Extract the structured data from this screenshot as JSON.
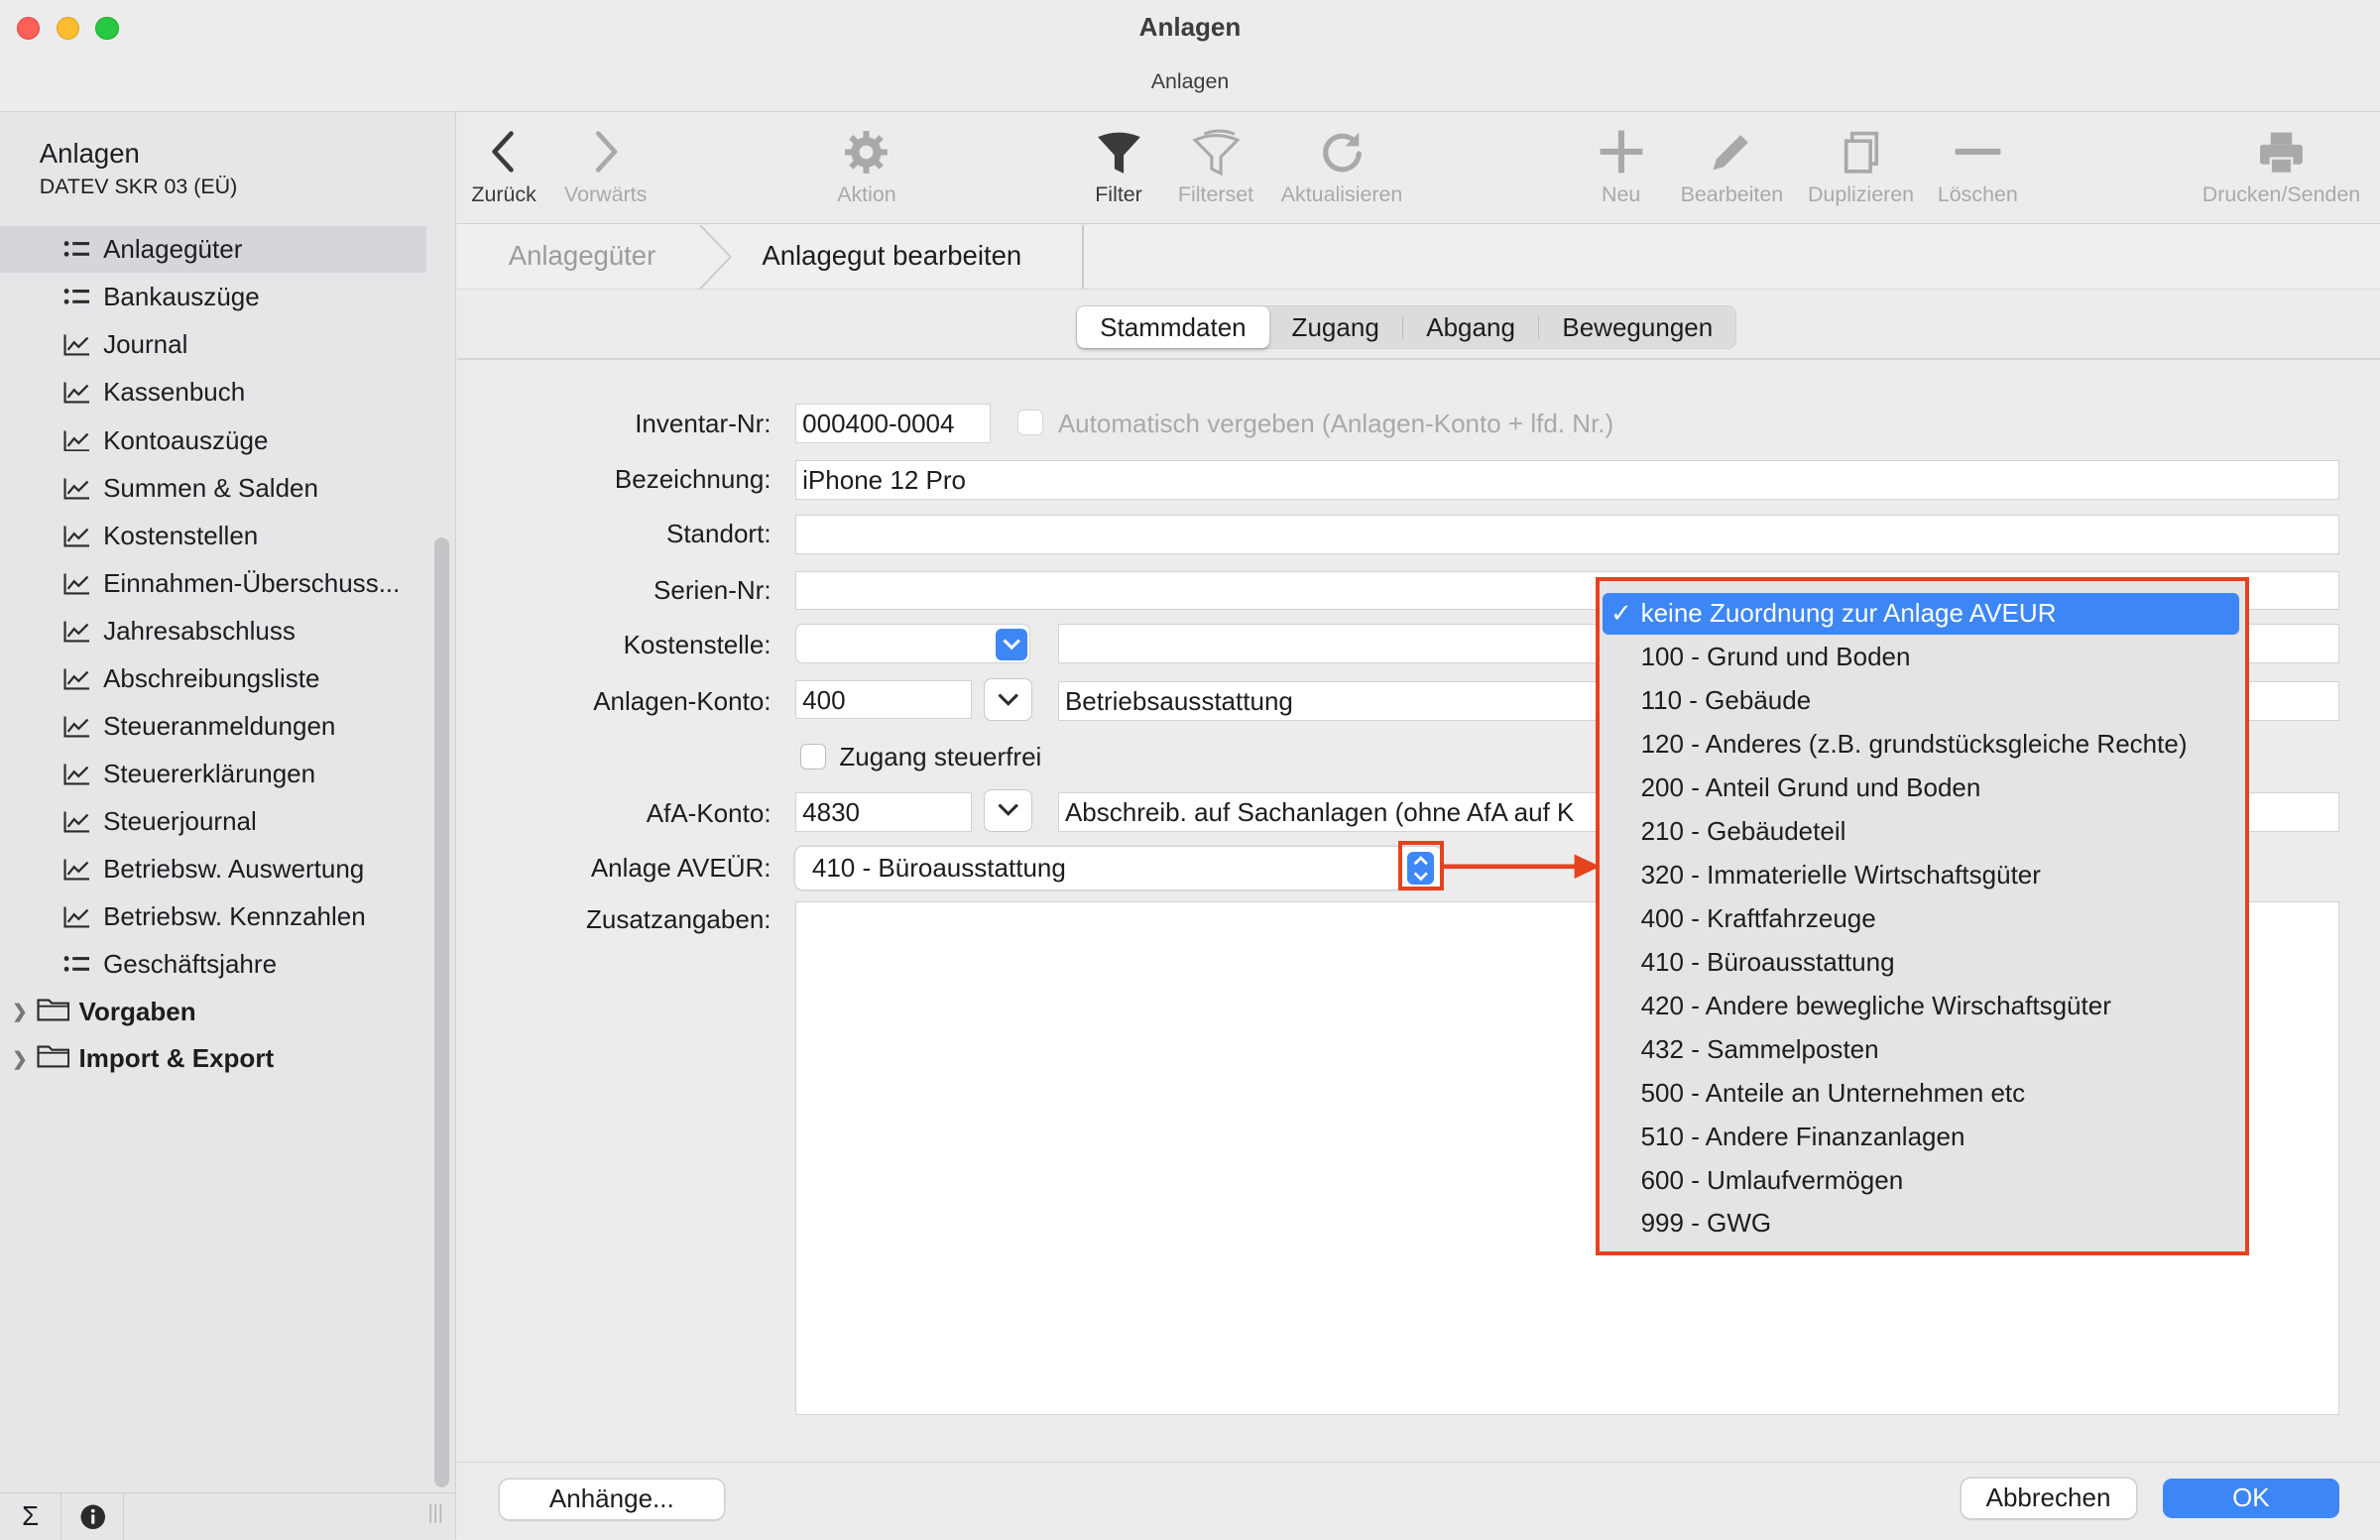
{
  "window": {
    "title": "Anlagen",
    "subtitle": "Anlagen"
  },
  "sidebar": {
    "title": "Anlagen",
    "subtitle": "DATEV SKR 03 (EÜ)",
    "items": [
      {
        "label": "Anlagegüter",
        "icon": "list-icon"
      },
      {
        "label": "Bankauszüge",
        "icon": "list-icon"
      },
      {
        "label": "Journal",
        "icon": "chart-icon"
      },
      {
        "label": "Kassenbuch",
        "icon": "chart-icon"
      },
      {
        "label": "Kontoauszüge",
        "icon": "chart-icon"
      },
      {
        "label": "Summen & Salden",
        "icon": "chart-icon"
      },
      {
        "label": "Kostenstellen",
        "icon": "chart-icon"
      },
      {
        "label": "Einnahmen-Überschuss...",
        "icon": "chart-icon"
      },
      {
        "label": "Jahresabschluss",
        "icon": "chart-icon"
      },
      {
        "label": "Abschreibungsliste",
        "icon": "chart-icon"
      },
      {
        "label": "Steueranmeldungen",
        "icon": "chart-icon"
      },
      {
        "label": "Steuererklärungen",
        "icon": "chart-icon"
      },
      {
        "label": "Steuerjournal",
        "icon": "chart-icon"
      },
      {
        "label": "Betriebsw. Auswertung",
        "icon": "chart-icon"
      },
      {
        "label": "Betriebsw. Kennzahlen",
        "icon": "chart-icon"
      },
      {
        "label": "Geschäftsjahre",
        "icon": "list-icon"
      }
    ],
    "folders": [
      {
        "label": "Vorgaben"
      },
      {
        "label": "Import & Export"
      }
    ]
  },
  "toolbar": {
    "back": "Zurück",
    "forward": "Vorwärts",
    "action": "Aktion",
    "filter": "Filter",
    "filterset": "Filterset",
    "refresh": "Aktualisieren",
    "new": "Neu",
    "edit": "Bearbeiten",
    "duplicate": "Duplizieren",
    "delete": "Löschen",
    "print": "Drucken/Senden"
  },
  "breadcrumb": {
    "parent": "Anlagegüter",
    "current": "Anlagegut bearbeiten"
  },
  "tabs": [
    "Stammdaten",
    "Zugang",
    "Abgang",
    "Bewegungen"
  ],
  "form": {
    "inventar_label": "Inventar-Nr:",
    "inventar_value": "000400-0004",
    "auto_assign": "Automatisch vergeben (Anlagen-Konto + lfd. Nr.)",
    "bezeichnung_label": "Bezeichnung:",
    "bezeichnung_value": "iPhone 12 Pro",
    "standort_label": "Standort:",
    "serien_label": "Serien-Nr:",
    "kostenstelle_label": "Kostenstelle:",
    "konto_label": "Anlagen-Konto:",
    "konto_value": "400",
    "konto_desc": "Betriebsausstattung",
    "zugang_steuerfrei": "Zugang steuerfrei",
    "afa_label": "AfA-Konto:",
    "afa_value": "4830",
    "afa_desc": "Abschreib. auf Sachanlagen (ohne AfA auf K",
    "aveur_label": "Anlage AVEÜR:",
    "aveur_value": "410 - Büroausstattung",
    "zusatz_label": "Zusatzangaben:"
  },
  "menu": {
    "options": [
      "keine Zuordnung zur Anlage AVEUR",
      "100 - Grund und Boden",
      "110 - Gebäude",
      "120 - Anderes (z.B. grundstücksgleiche Rechte)",
      "200 - Anteil Grund und Boden",
      "210 - Gebäudeteil",
      "320 - Immaterielle Wirtschaftsgüter",
      "400 - Kraftfahrzeuge",
      "410 - Büroausstattung",
      "420 - Andere bewegliche Wirschaftsgüter",
      "432 - Sammelposten",
      "500 - Anteile an Unternehmen etc",
      "510 - Andere Finanzanlagen",
      "600 - Umlaufvermögen",
      "999 - GWG"
    ],
    "checkmark": "✓",
    "accent": "#3d86f5",
    "highlight": "#e5421f"
  },
  "footer": {
    "attachments": "Anhänge...",
    "cancel": "Abbrechen",
    "ok": "OK"
  }
}
